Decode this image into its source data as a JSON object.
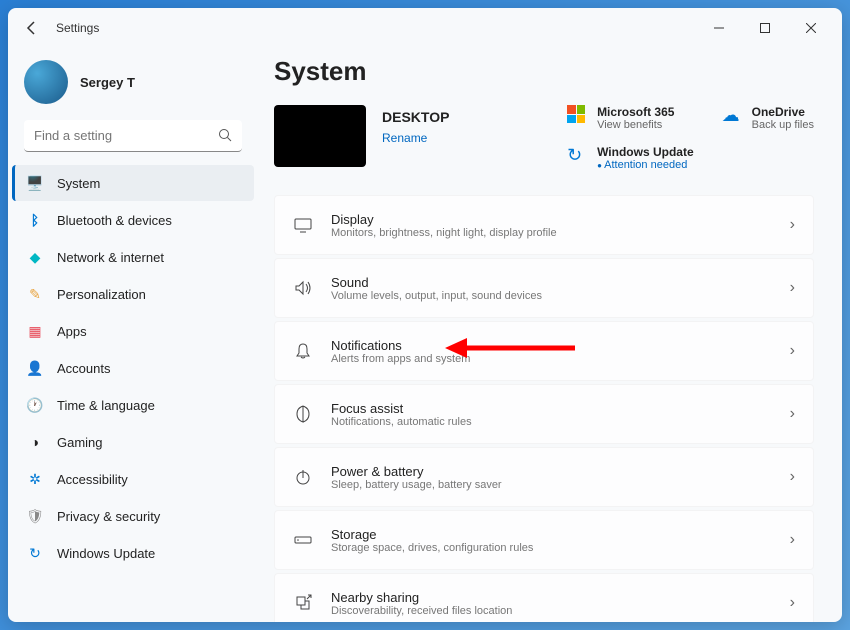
{
  "window": {
    "title": "Settings"
  },
  "user": {
    "name": "Sergey T"
  },
  "search": {
    "placeholder": "Find a setting"
  },
  "nav": [
    {
      "label": "System",
      "icon": "🖥️",
      "color": "#0078d4"
    },
    {
      "label": "Bluetooth & devices",
      "icon": "B",
      "color": "#0078d4"
    },
    {
      "label": "Network & internet",
      "icon": "◆",
      "color": "#00b7c3"
    },
    {
      "label": "Personalization",
      "icon": "✎",
      "color": "#e8a33d"
    },
    {
      "label": "Apps",
      "icon": "▦",
      "color": "#e74856"
    },
    {
      "label": "Accounts",
      "icon": "👤",
      "color": "#0078d4"
    },
    {
      "label": "Time & language",
      "icon": "🕐",
      "color": "#555"
    },
    {
      "label": "Gaming",
      "icon": "◔",
      "color": "#555"
    },
    {
      "label": "Accessibility",
      "icon": "✲",
      "color": "#0078d4"
    },
    {
      "label": "Privacy & security",
      "icon": "🛡",
      "color": "#888"
    },
    {
      "label": "Windows Update",
      "icon": "↻",
      "color": "#0078d4"
    }
  ],
  "page": {
    "title": "System"
  },
  "device": {
    "name": "DESKTOP",
    "rename": "Rename"
  },
  "promos": {
    "ms365": {
      "title": "Microsoft 365",
      "sub": "View benefits"
    },
    "onedrive": {
      "title": "OneDrive",
      "sub": "Back up files"
    },
    "update": {
      "title": "Windows Update",
      "sub": "Attention needed"
    }
  },
  "settings": [
    {
      "title": "Display",
      "sub": "Monitors, brightness, night light, display profile"
    },
    {
      "title": "Sound",
      "sub": "Volume levels, output, input, sound devices"
    },
    {
      "title": "Notifications",
      "sub": "Alerts from apps and system"
    },
    {
      "title": "Focus assist",
      "sub": "Notifications, automatic rules"
    },
    {
      "title": "Power & battery",
      "sub": "Sleep, battery usage, battery saver"
    },
    {
      "title": "Storage",
      "sub": "Storage space, drives, configuration rules"
    },
    {
      "title": "Nearby sharing",
      "sub": "Discoverability, received files location"
    }
  ]
}
